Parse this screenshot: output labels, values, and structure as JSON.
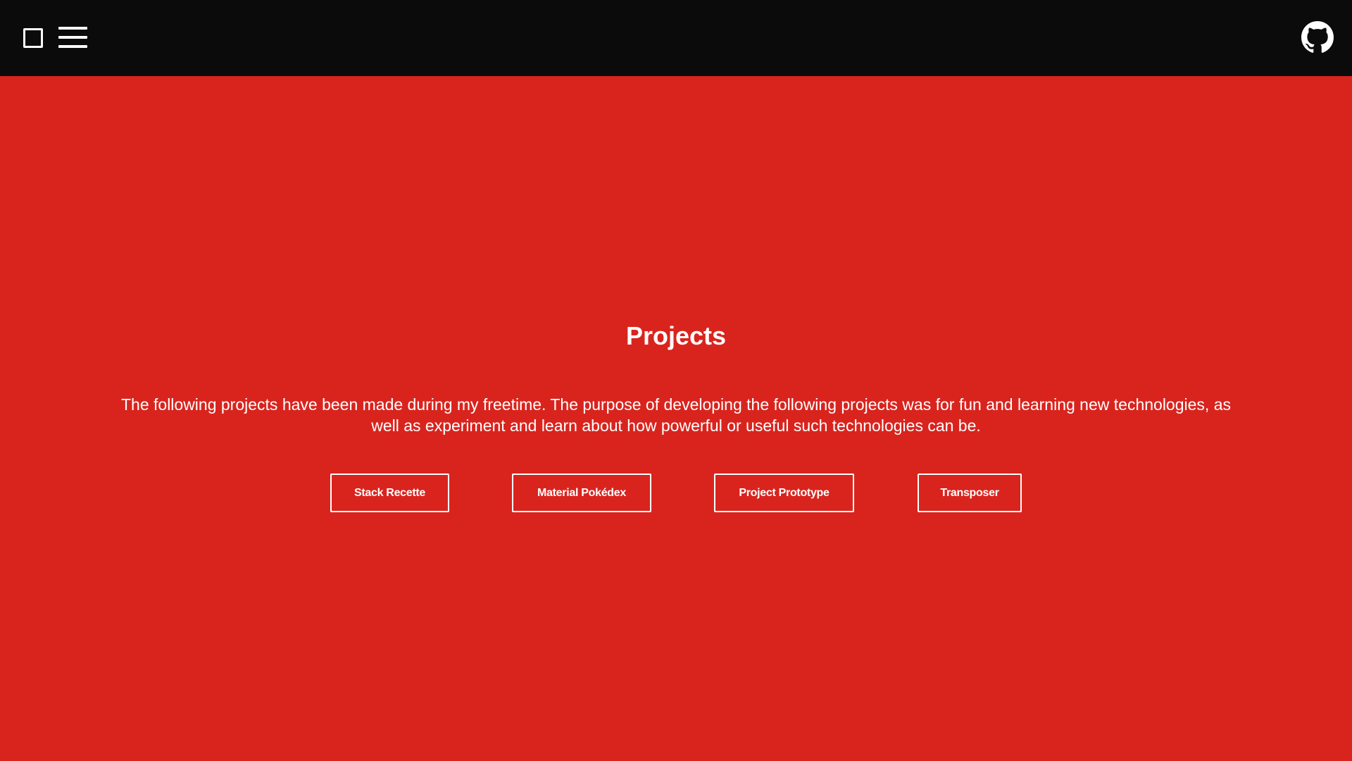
{
  "header": {
    "left_icons": [
      "square-icon",
      "hamburger-menu-icon"
    ],
    "right_icon": "github-icon"
  },
  "main": {
    "title": "Projects",
    "description": "The following projects have been made during my freetime. The purpose of developing the following projects was for fun and learning new technologies, as well as experiment and learn about how powerful or useful such technologies can be.",
    "projects": [
      {
        "label": "Stack Recette"
      },
      {
        "label": "Material Pokédex"
      },
      {
        "label": "Project Prototype"
      },
      {
        "label": "Transposer"
      }
    ]
  },
  "colors": {
    "header_background": "#0b0b0c",
    "page_background": "#d9241e",
    "foreground": "#ffffff"
  }
}
